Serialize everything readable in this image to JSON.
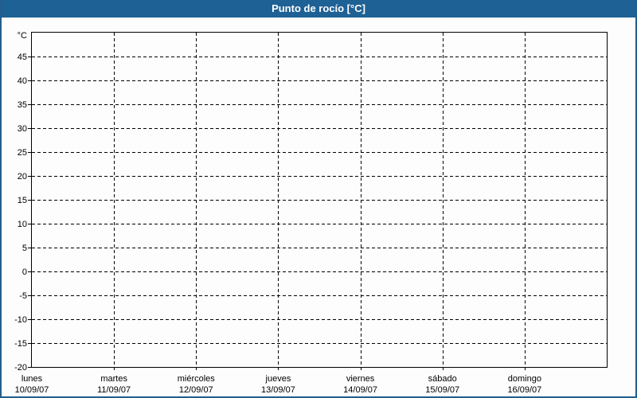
{
  "window": {
    "title": "Punto de rocío [°C]",
    "title_bar_color": "#1e6195",
    "border_color": "#235e8c",
    "background_color": "#fcfdfc"
  },
  "chart_data": {
    "type": "line",
    "title": "Punto de rocío [°C]",
    "y_unit_label": "°C",
    "ylim": [
      -20,
      50
    ],
    "ytick_step": 5,
    "yticks": [
      45,
      40,
      35,
      30,
      25,
      20,
      15,
      10,
      5,
      0,
      -5,
      -10,
      -15,
      -20
    ],
    "x_categories": [
      {
        "day": "lunes",
        "date": "10/09/07"
      },
      {
        "day": "martes",
        "date": "11/09/07"
      },
      {
        "day": "miércoles",
        "date": "12/09/07"
      },
      {
        "day": "jueves",
        "date": "13/09/07"
      },
      {
        "day": "viernes",
        "date": "14/09/07"
      },
      {
        "day": "sábado",
        "date": "15/09/07"
      },
      {
        "day": "domingo",
        "date": "16/09/07"
      }
    ],
    "series": [],
    "grid": "dashed",
    "legend": "none",
    "axis_color": "#000000",
    "grid_color": "#000000"
  }
}
